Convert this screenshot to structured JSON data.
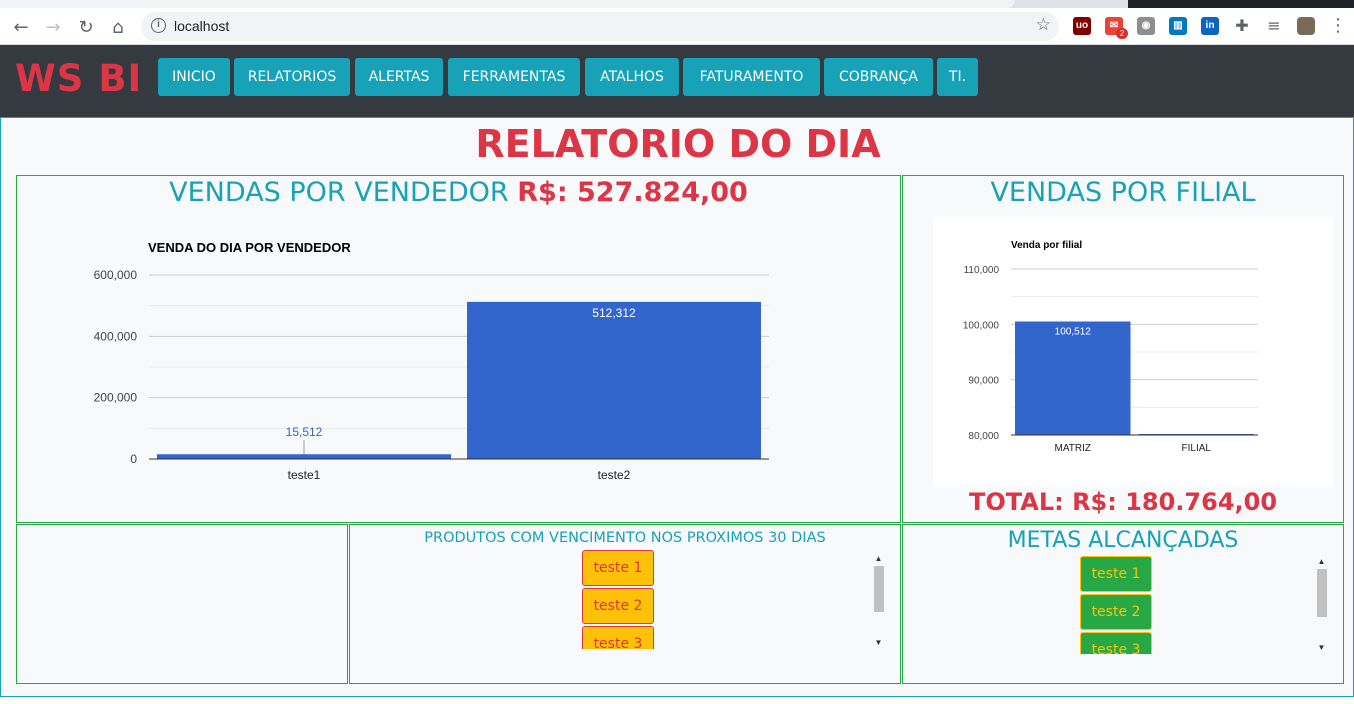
{
  "browser": {
    "url": "localhost",
    "badge_count": "2"
  },
  "app": {
    "brand": "WS BI",
    "menu": [
      "INICIO",
      "RELATORIOS",
      "ALERTAS",
      "FERRAMENTAS",
      "ATALHOS",
      "FATURAMENTO",
      "COBRANÇA",
      "TI."
    ],
    "page_title": "RELATORIO DO DIA"
  },
  "colors": {
    "danger": "#dc3545",
    "info": "#17a2b8",
    "success": "#28a745",
    "warning": "#ffc107",
    "dark": "#343a40",
    "bar": "#3366cc"
  },
  "sales_by_seller": {
    "title": "VENDAS POR VENDEDOR",
    "total": "R$: 527.824,00"
  },
  "sales_by_branch": {
    "title": "VENDAS POR FILIAL",
    "total": "TOTAL: R$: 180.764,00"
  },
  "expiring_products": {
    "title": "PRODUTOS COM VENCIMENTO NOS PROXIMOS 30 DIAS",
    "items": [
      "teste 1",
      "teste 2",
      "teste 3"
    ]
  },
  "goals": {
    "title": "METAS ALCANÇADAS",
    "items": [
      "teste 1",
      "teste 2",
      "teste 3"
    ]
  },
  "chart_data": [
    {
      "type": "bar",
      "title": "VENDA DO DIA POR VENDEDOR",
      "categories": [
        "teste1",
        "teste2"
      ],
      "values": [
        15512,
        512312
      ],
      "data_labels": [
        "15,512",
        "512,312"
      ],
      "ylim": [
        0,
        600000
      ],
      "yticks": [
        "0",
        "200,000",
        "400,000",
        "600,000"
      ],
      "ytick_values": [
        0,
        200000,
        400000,
        600000
      ],
      "grid": true
    },
    {
      "type": "bar",
      "title": "Venda por filial",
      "categories": [
        "MATRIZ",
        "FILIAL"
      ],
      "values": [
        100512,
        80000
      ],
      "data_labels": [
        "100,512",
        ""
      ],
      "ylim": [
        80000,
        110000
      ],
      "yticks": [
        "80,000",
        "90,000",
        "100,000",
        "110,000"
      ],
      "ytick_values": [
        80000,
        90000,
        100000,
        110000
      ],
      "grid": true
    }
  ]
}
